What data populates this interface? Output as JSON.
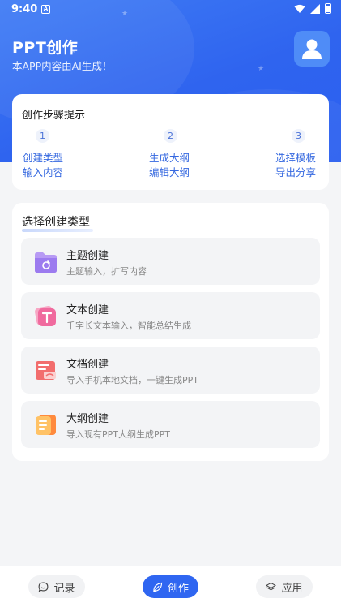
{
  "status_bar": {
    "time": "9:40",
    "notif_letter": "A"
  },
  "header": {
    "title": "PPT创作",
    "subtitle": "本APP内容由AI生成！"
  },
  "steps": {
    "title": "创作步骤提示",
    "items": [
      {
        "number": "1",
        "line1": "创建类型",
        "line2": "输入内容"
      },
      {
        "number": "2",
        "line1": "生成大纲",
        "line2": "编辑大纲"
      },
      {
        "number": "3",
        "line1": "选择模板",
        "line2": "导出分享"
      }
    ]
  },
  "types": {
    "title": "选择创建类型",
    "items": [
      {
        "name": "主题创建",
        "desc": "主题输入，扩写内容",
        "icon": "folder-icon"
      },
      {
        "name": "文本创建",
        "desc": "千字长文本输入，智能总结生成",
        "icon": "text-icon"
      },
      {
        "name": "文档创建",
        "desc": "导入手机本地文档，一键生成PPT",
        "icon": "document-icon"
      },
      {
        "name": "大纲创建",
        "desc": "导入现有PPT大纲生成PPT",
        "icon": "outline-icon"
      }
    ]
  },
  "bottom_nav": {
    "items": [
      {
        "label": "记录",
        "icon": "chat-icon",
        "active": false
      },
      {
        "label": "创作",
        "icon": "leaf-icon",
        "active": true
      },
      {
        "label": "应用",
        "icon": "layers-icon",
        "active": false
      }
    ]
  },
  "colors": {
    "primary": "#2f66f1",
    "step_text": "#3669e0",
    "background": "#f4f5f7"
  }
}
